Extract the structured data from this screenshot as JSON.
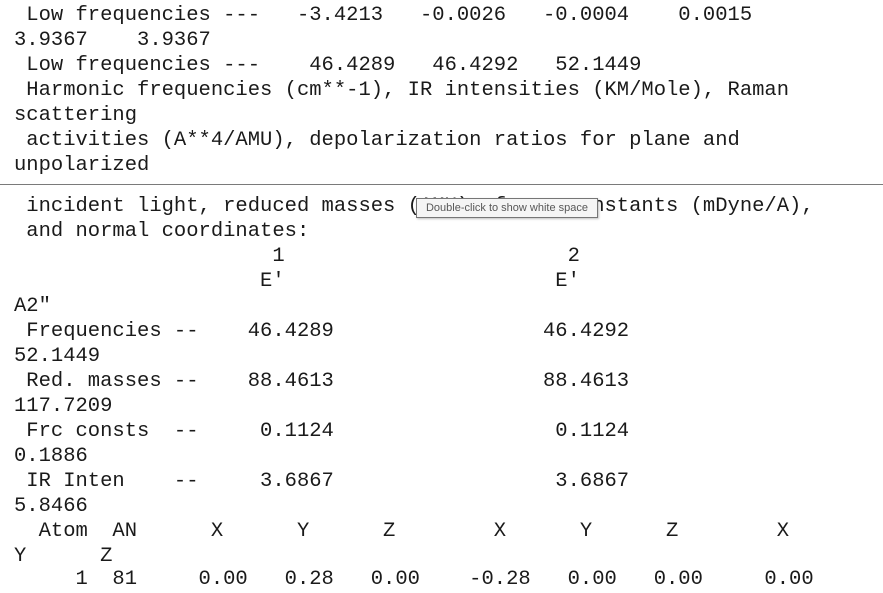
{
  "document": {
    "page1_lines": [
      " Low frequencies ---   -3.4213   -0.0026   -0.0004    0.0015",
      "3.9367    3.9367",
      " Low frequencies ---    46.4289   46.4292   52.1449",
      " Harmonic frequencies (cm**-1), IR intensities (KM/Mole), Raman",
      "scattering",
      " activities (A**4/AMU), depolarization ratios for plane and",
      "unpolarized"
    ],
    "page2_lines": [
      " incident light, reduced masses (AMU), force constants (mDyne/A),",
      " and normal coordinates:",
      "                     1                       2",
      "                    E'                      E'",
      "A2\"",
      " Frequencies --    46.4289                 46.4292",
      "52.1449",
      " Red. masses --    88.4613                 88.4613",
      "117.7209",
      " Frc consts  --     0.1124                  0.1124",
      "0.1886",
      " IR Inten    --     3.6867                  3.6867",
      "5.8466",
      "  Atom  AN      X      Y      Z        X      Y      Z        X",
      "Y      Z",
      "     1  81     0.00   0.28   0.00    -0.28   0.00   0.00     0.00"
    ]
  },
  "tooltip": {
    "text": "Double-click to show white space"
  }
}
